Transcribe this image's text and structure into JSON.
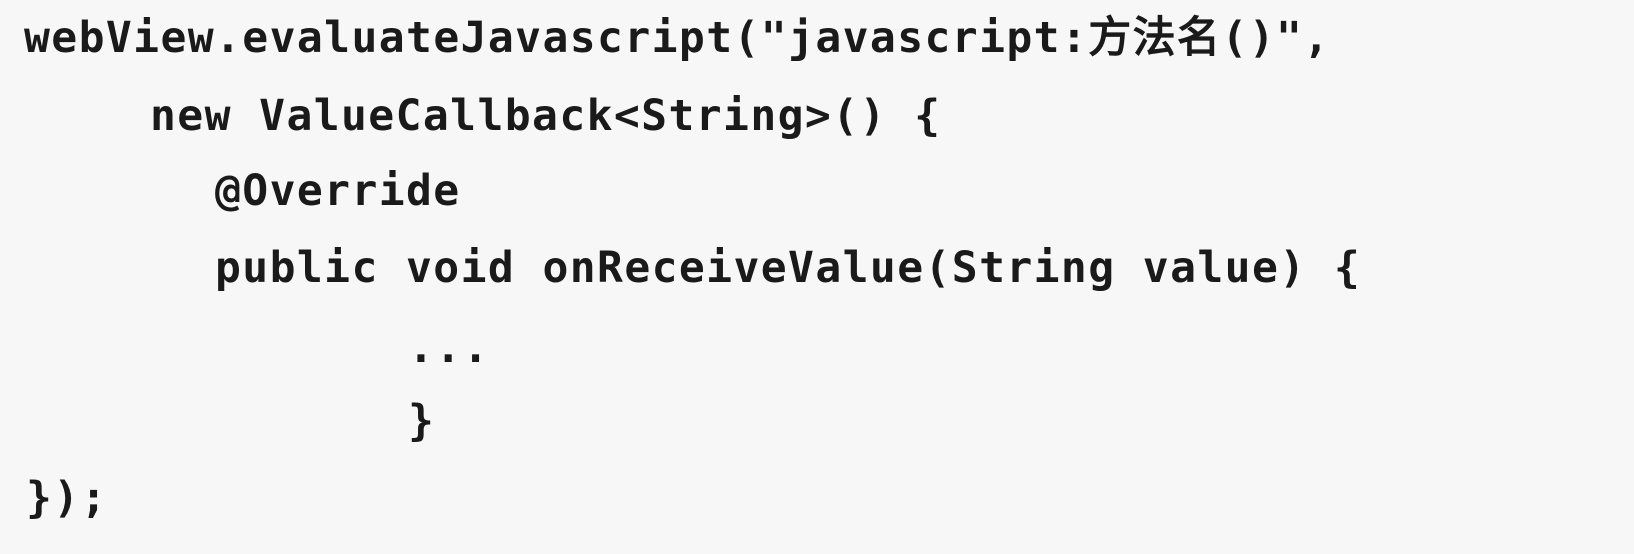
{
  "code": {
    "lines": [
      "webView.evaluateJavascript(\"javascript:方法名()\",",
      "new ValueCallback<String>() {",
      "@Override",
      "public void onReceiveValue(String value) {",
      "...",
      "}",
      "});"
    ]
  }
}
